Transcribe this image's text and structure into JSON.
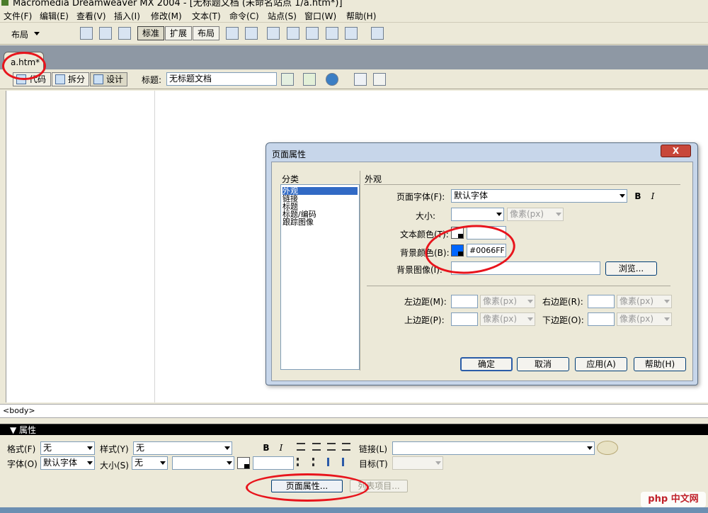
{
  "window": {
    "title": "Macromedia Dreamweaver MX 2004 - [无标题文档 (未命名站点 1/a.htm*)]"
  },
  "menu": [
    "文件(F)",
    "编辑(E)",
    "查看(V)",
    "插入(I)",
    "修改(M)",
    "文本(T)",
    "命令(C)",
    "站点(S)",
    "窗口(W)",
    "帮助(H)"
  ],
  "insert_bar": {
    "category": "布局",
    "modes": [
      "标准",
      "扩展",
      "布局"
    ]
  },
  "document": {
    "tab": "a.htm*",
    "views": [
      "代码",
      "拆分",
      "设计"
    ],
    "title_label": "标题:",
    "title_value": "无标题文档"
  },
  "status": {
    "tag": "<body>"
  },
  "properties": {
    "header": "▼ 属性",
    "format_label": "格式(F)",
    "format_value": "无",
    "style_label": "样式(Y)",
    "style_value": "无",
    "font_label": "字体(O)",
    "font_value": "默认字体",
    "size_label": "大小(S)",
    "size_value": "无",
    "link_label": "链接(L)",
    "target_label": "目标(T)",
    "bold": "B",
    "italic": "I",
    "page_props_button": "页面属性...",
    "list_item_button": "列表项目..."
  },
  "dialog": {
    "title": "页面属性",
    "close": "X",
    "category_header": "分类",
    "categories": [
      "外观",
      "链接",
      "标题",
      "标题/编码",
      "跟踪图像"
    ],
    "selected_category": 0,
    "section": "外观",
    "page_font_label": "页面字体(F):",
    "page_font_value": "默认字体",
    "size_label": "大小:",
    "size_unit": "像素(px)",
    "text_color_label": "文本颜色(T):",
    "bg_color_label": "背景颜色(B):",
    "bg_color_value": "#0066FF",
    "bg_image_label": "背景图像(I):",
    "browse_button": "浏览...",
    "left_margin_label": "左边距(M):",
    "right_margin_label": "右边距(R):",
    "top_margin_label": "上边距(P):",
    "bottom_margin_label": "下边距(O):",
    "margin_unit": "像素(px)",
    "ok_button": "确定",
    "cancel_button": "取消",
    "apply_button": "应用(A)",
    "help_button": "帮助(H)",
    "bold": "B",
    "italic": "I"
  },
  "watermark": "php 中文网",
  "colors": {
    "bg_color_swatch": "#0066FF",
    "dialog_frame": "#C7D6EA",
    "annotation": "#E8141C"
  }
}
